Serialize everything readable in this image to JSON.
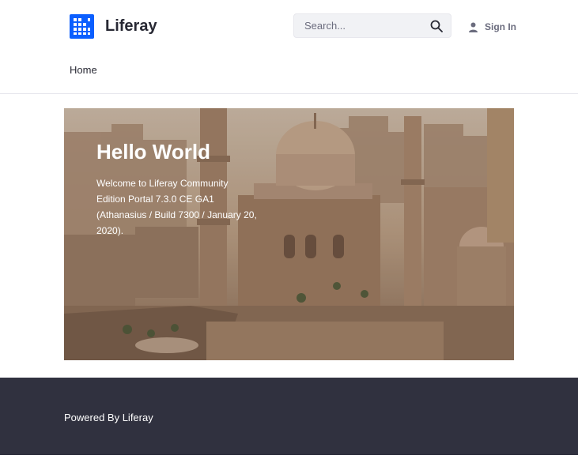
{
  "header": {
    "site_name": "Liferay",
    "logo_icon": "liferay-logo-icon",
    "search": {
      "placeholder": "Search...",
      "icon": "search-icon"
    },
    "sign_in": {
      "label": "Sign In",
      "icon": "user-icon"
    }
  },
  "nav": {
    "items": [
      {
        "label": "Home"
      }
    ]
  },
  "hero": {
    "title": "Hello World",
    "text": "Welcome to Liferay Community Edition Portal 7.3.0 CE GA1 (Athanasius / Build 7300 / January 20, 2020)."
  },
  "footer": {
    "text": "Powered By Liferay"
  },
  "colors": {
    "brand": "#0b5fff",
    "footer_bg": "#30313f",
    "text": "#272833",
    "muted": "#6b6c7e"
  }
}
